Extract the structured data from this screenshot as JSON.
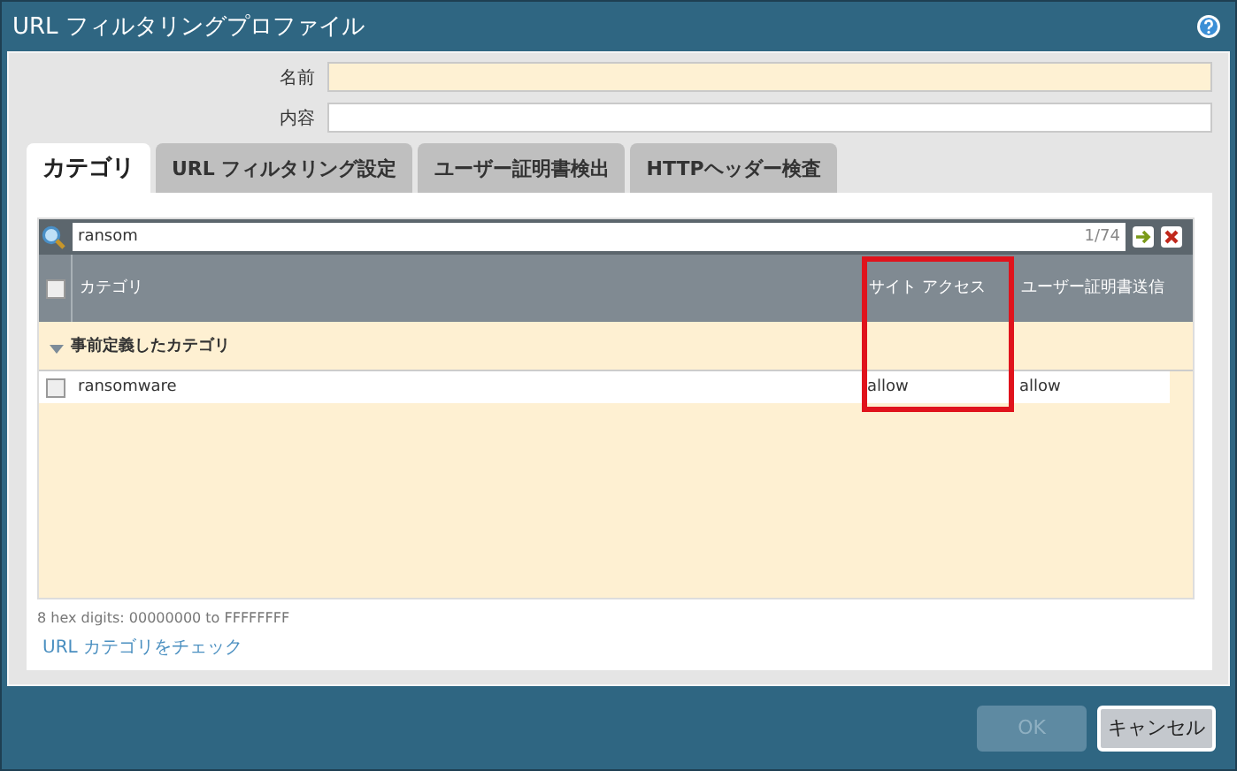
{
  "window": {
    "title": "URL フィルタリングプロファイル"
  },
  "fields": [
    {
      "label": "名前",
      "required": true
    },
    {
      "label": "内容",
      "required": false
    }
  ],
  "tabs": [
    {
      "label": "カテゴリ",
      "selected": true
    },
    {
      "label": "URL フィルタリング設定",
      "selected": false
    },
    {
      "label": "ユーザー証明書検出",
      "selected": false
    },
    {
      "label": "HTTPヘッダー検査",
      "selected": false
    }
  ],
  "search": {
    "value": "ransom",
    "count": "1/74"
  },
  "table": {
    "select_all": false,
    "columns": [
      {
        "label": "カテゴリ",
        "highlighted": false
      },
      {
        "label": "サイト アクセス",
        "highlighted": true
      },
      {
        "label": "ユーザー証明書送信",
        "highlighted": false
      }
    ],
    "groups": [
      {
        "label": "事前定義したカテゴリ",
        "expanded": true,
        "rows": [
          {
            "checked": false,
            "cells": [
              "ransomware",
              "allow",
              "allow"
            ]
          }
        ]
      }
    ]
  },
  "hint": "8 hex digits: 00000000 to FFFFFFFF",
  "link": "URL カテゴリをチェック",
  "buttons": [
    {
      "label": "OK",
      "disabled": true
    },
    {
      "label": "キャンセル",
      "disabled": false
    }
  ]
}
